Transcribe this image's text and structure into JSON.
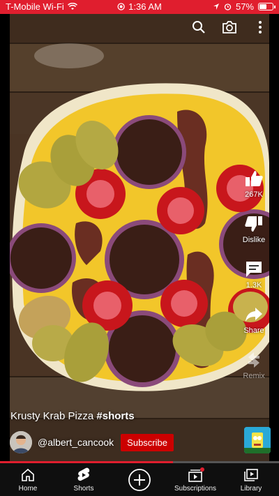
{
  "status_bar": {
    "carrier": "T-Mobile Wi-Fi",
    "time": "1:36 AM",
    "battery": "57%",
    "battery_level": 0.57,
    "icons": [
      "wifi-icon",
      "alarm-icon",
      "location-icon",
      "battery-icon"
    ]
  },
  "top_actions": {
    "icons": [
      "search-icon",
      "camera-icon",
      "more-icon"
    ]
  },
  "actions": {
    "like_count": "267K",
    "dislike_label": "Dislike",
    "comment_count": "1.3K",
    "share_label": "Share",
    "remix_label": "Remix"
  },
  "video": {
    "title": "Krusty Krab Pizza",
    "hashtag": "#shorts",
    "channel_handle": "@albert_cancook",
    "subscribe_label": "Subscribe",
    "progress": 0.62
  },
  "nav": {
    "tabs": [
      {
        "label": "Home",
        "icon": "home-icon"
      },
      {
        "label": "Shorts",
        "icon": "shorts-icon"
      },
      {
        "label": "",
        "icon": "create-icon"
      },
      {
        "label": "Subscriptions",
        "icon": "subscriptions-icon"
      },
      {
        "label": "Library",
        "icon": "library-icon"
      }
    ]
  },
  "colors": {
    "brand_red": "#e01e2e",
    "subscribe_red": "#cc0000",
    "nav_bg": "#0f0f0f"
  }
}
